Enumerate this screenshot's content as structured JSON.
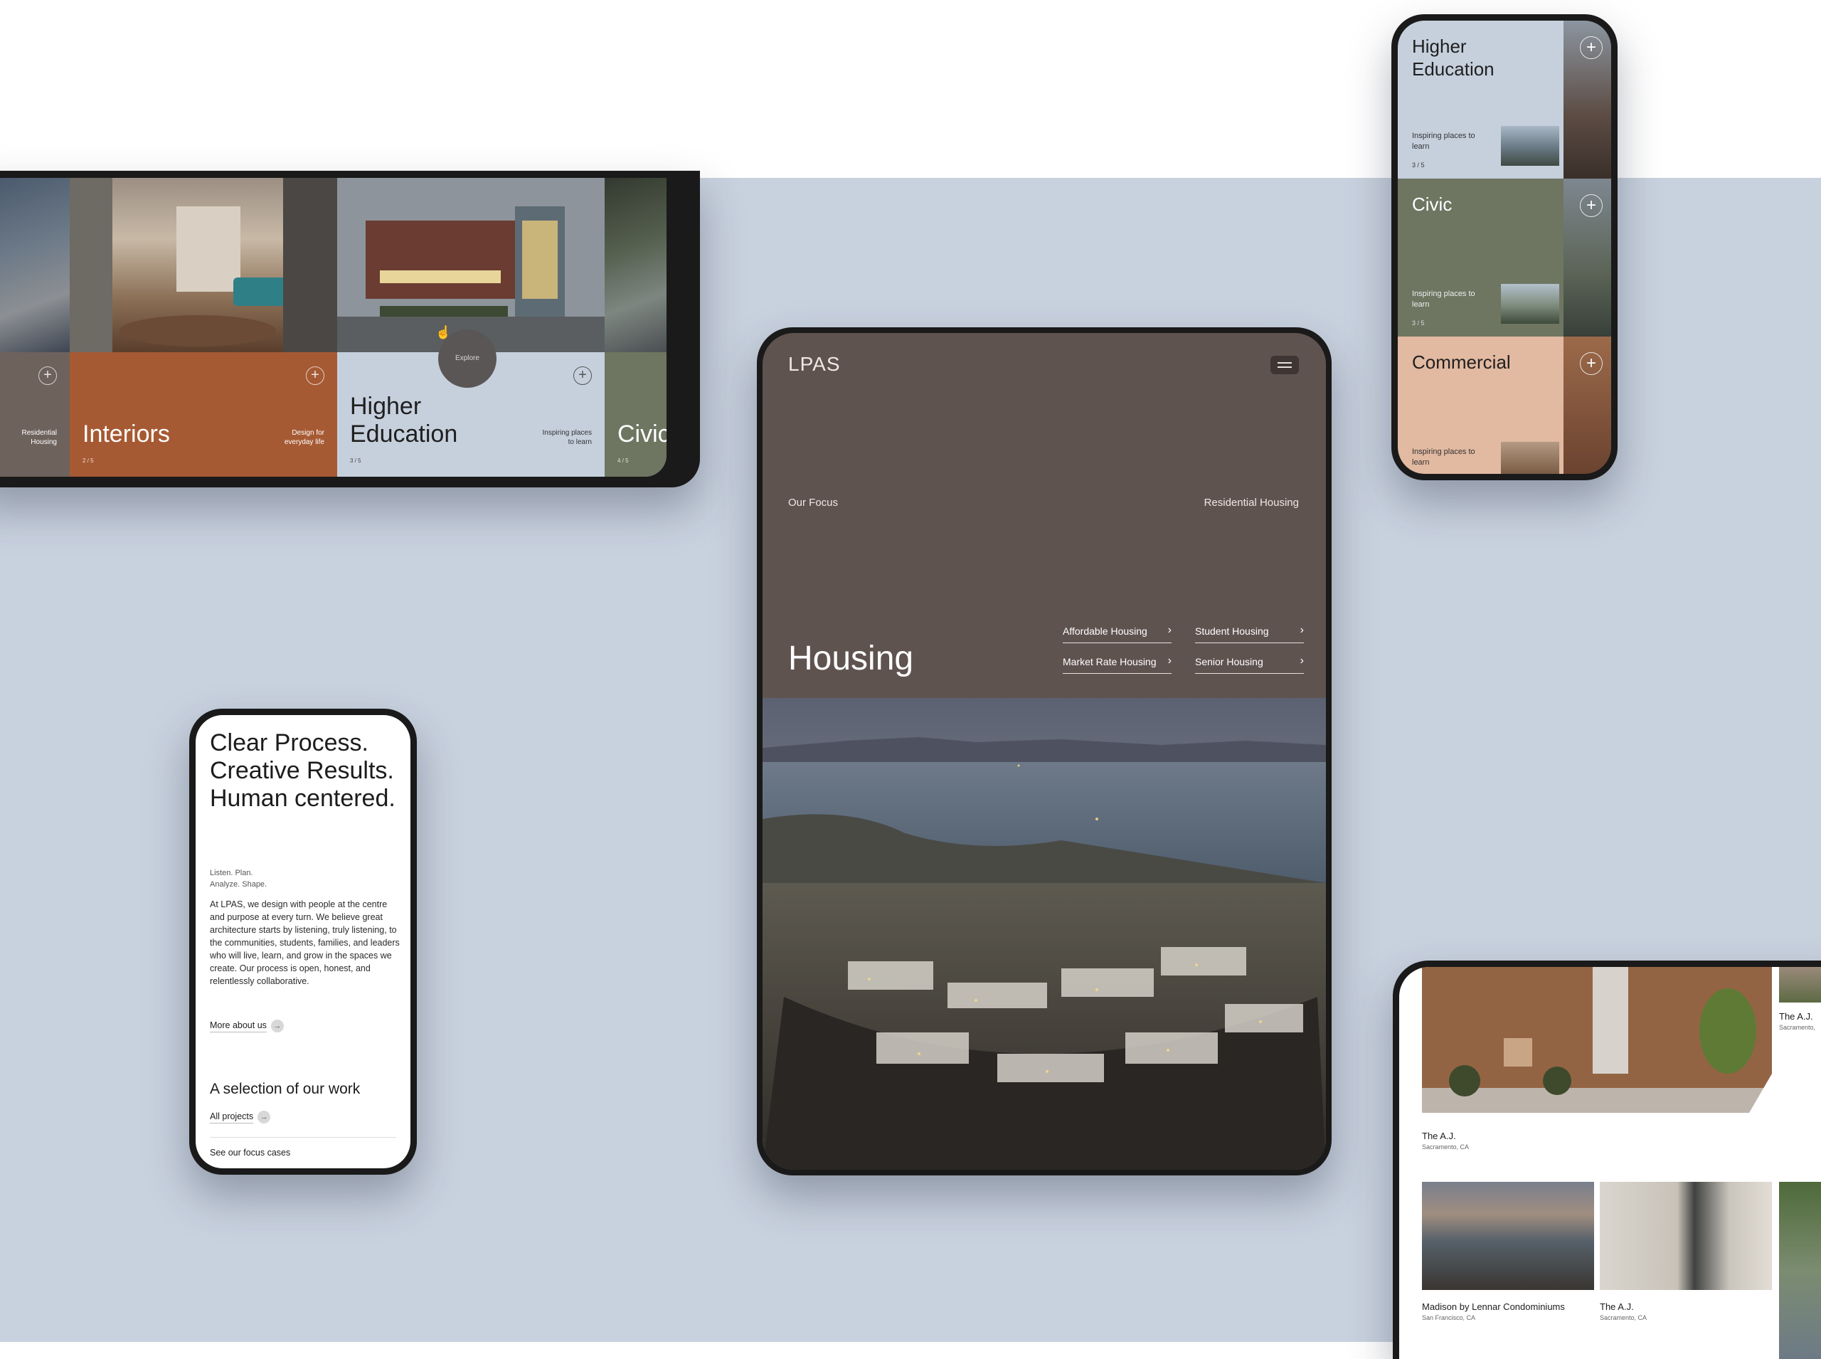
{
  "laptop": {
    "columns": [
      {
        "label": "",
        "subtitle": "Residential Housing",
        "index": ""
      },
      {
        "label": "Interiors",
        "subtitle": "Design for everyday life",
        "index": "2 / 5"
      },
      {
        "label": "Higher Education",
        "subtitle": "Inspiring places to learn",
        "index": "3 / 5"
      },
      {
        "label": "Civic",
        "subtitle": "",
        "index": "4 / 5"
      }
    ],
    "explore_label": "Explore",
    "plus_glyph": "+"
  },
  "phone_right": {
    "rows": [
      {
        "title": "Higher Education",
        "subtitle": "Inspiring places to learn",
        "index": "3 / 5",
        "color": "#c6d0dd"
      },
      {
        "title": "Civic",
        "subtitle": "Inspiring places to learn",
        "index": "3 / 5",
        "color": "#6e7561"
      },
      {
        "title": "Commercial",
        "subtitle": "Inspiring places to learn",
        "index": "",
        "color": "#e2b9a1"
      }
    ],
    "plus_glyph": "+"
  },
  "tablet": {
    "logo": "LPAS",
    "eyebrow_left": "Our Focus",
    "eyebrow_right": "Residential Housing",
    "title": "Housing",
    "links": [
      "Affordable Housing",
      "Student Housing",
      "Market Rate Housing",
      "Senior Housing"
    ],
    "chevron": "›"
  },
  "phone_left": {
    "headline": "Clear Process. Creative Results. Human centered.",
    "meta_line1": "Listen. Plan.",
    "meta_line2": "Analyze. Shape.",
    "body": "At LPAS, we design with people at the centre and purpose at every turn. We believe great architecture starts by listening, truly listening, to the communities, students, families, and leaders who will live, learn, and grow in the spaces we create. Our process is open, honest, and relentlessly collaborative.",
    "more_link": "More about us",
    "selection_title": "A selection of our work",
    "all_projects": "All projects",
    "focus_cases": "See our focus cases",
    "arrow": "→"
  },
  "tablet_br": {
    "projects": [
      {
        "title": "The A.J.",
        "location": "Sacramento, CA"
      },
      {
        "title": "The A.J.",
        "location": "Sacramento,"
      },
      {
        "title": "Madison by Lennar Condominiums",
        "location": "San Francisco, CA"
      },
      {
        "title": "The A.J.",
        "location": "Sacramento, CA"
      }
    ]
  },
  "colors": {
    "page_bg": "#c8d1de",
    "tablet_bg": "#5f5350",
    "interiors": "#a65a33",
    "higher_ed": "#c6d0dd",
    "civic": "#6e7561"
  }
}
